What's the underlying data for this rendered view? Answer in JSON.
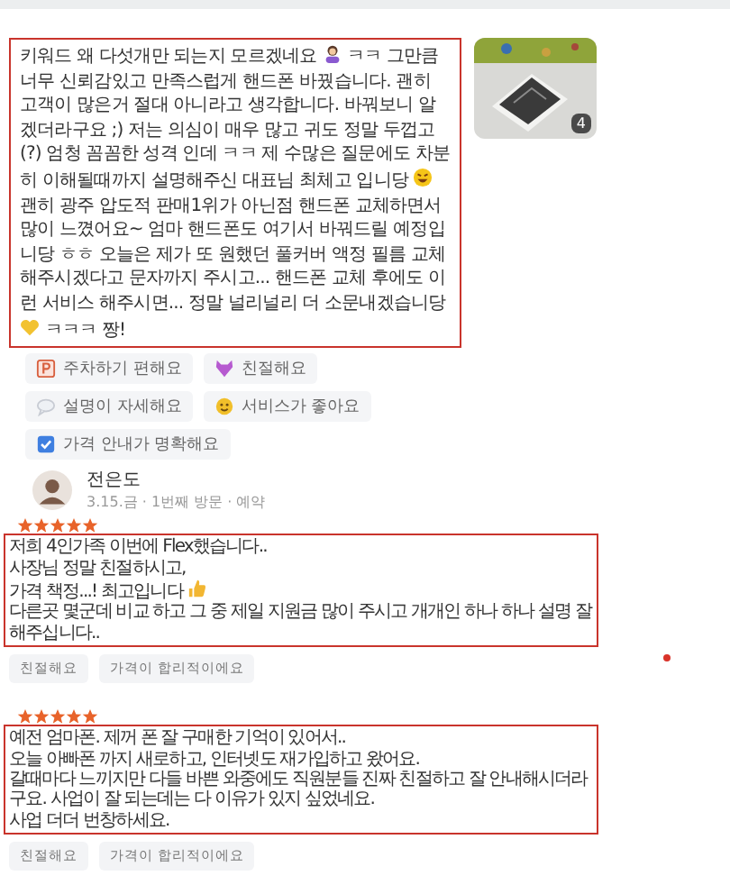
{
  "first_review": {
    "segments": [
      {
        "kind": "text",
        "text": "키워드 왜 다섯개만 되는지 모르겠네요 "
      },
      {
        "kind": "person"
      },
      {
        "kind": "text",
        "text": " ㅋㅋ 그만큼 너무 신뢰감있고 만족스럽게 핸드폰 바꿨습니다. 괜히 고객이 많은거 절대 아니라고 생각합니다. 바꿔보니 알겠더라구요 ;) 저는 의심이 매우 많고 귀도 정말 두껍고 (?) 엄청 꼼꼼한 성격 인데 ㅋㅋ 제 수많은 질문에도 차분히 이해될때까지 설명해주신 대표님 최체고 입니당 "
      },
      {
        "kind": "laugh"
      },
      {
        "kind": "text",
        "text": " 괜히 광주 압도적 판매1위가 아닌점 핸드폰 교체하면서 많이 느꼈어요~ 엄마 핸드폰도 여기서 바꿔드릴 예정입니당 ㅎㅎ 오늘은 제가 또 원했던 풀커버 액정 필름 교체해주시겠다고 문자까지 주시고... 핸드폰 교체 후에도 이런 서비스 해주시면... 정말 널리널리 더 소문내겠습니당"
      },
      {
        "kind": "heart"
      },
      {
        "kind": "text",
        "text": " ㅋㅋㅋ 짱!"
      }
    ],
    "photo_count": "4",
    "tags": [
      {
        "kind": "parking",
        "label": "주차하기 편해요"
      },
      {
        "kind": "devil",
        "label": "친절해요"
      },
      {
        "kind": "bubble",
        "label": "설명이 자세해요"
      },
      {
        "kind": "smile",
        "label": "서비스가 좋아요"
      },
      {
        "kind": "check",
        "label": "가격 안내가 명확해요"
      }
    ]
  },
  "reviewer": {
    "name": "전은도",
    "meta": "3.15.금 · 1번째 방문 · 예약"
  },
  "reviews": [
    {
      "stars": 5,
      "segments": [
        {
          "kind": "text",
          "text": "저희 4인가족 이번에 Flex했습니다..\n사장님 정말 친절하시고,\n가격 책정...! 최고입니다 "
        },
        {
          "kind": "thumb"
        },
        {
          "kind": "text",
          "text": "\n다른곳 몇군데 비교 하고 그 중 제일 지원금 많이 주시고 개개인 하나 하나 설명 잘해주십니다.."
        }
      ],
      "tags": [
        "친절해요",
        "가격이 합리적이에요"
      ]
    },
    {
      "stars": 5,
      "segments": [
        {
          "kind": "text",
          "text": "예전 엄마폰. 제꺼 폰 잘 구매한 기억이 있어서..\n오늘 아빠폰 까지 새로하고, 인터넷도 재가입하고 왔어요.\n갈때마다 느끼지만 다들 바쁜 와중에도 직원분들 진짜 친절하고 잘 안내해시더라구요. 사업이 잘 되는데는 다 이유가 있지 싶었네요.\n사업 더더 번창하세요."
        }
      ],
      "tags": [
        "친절해요",
        "가격이 합리적이에요"
      ]
    }
  ]
}
